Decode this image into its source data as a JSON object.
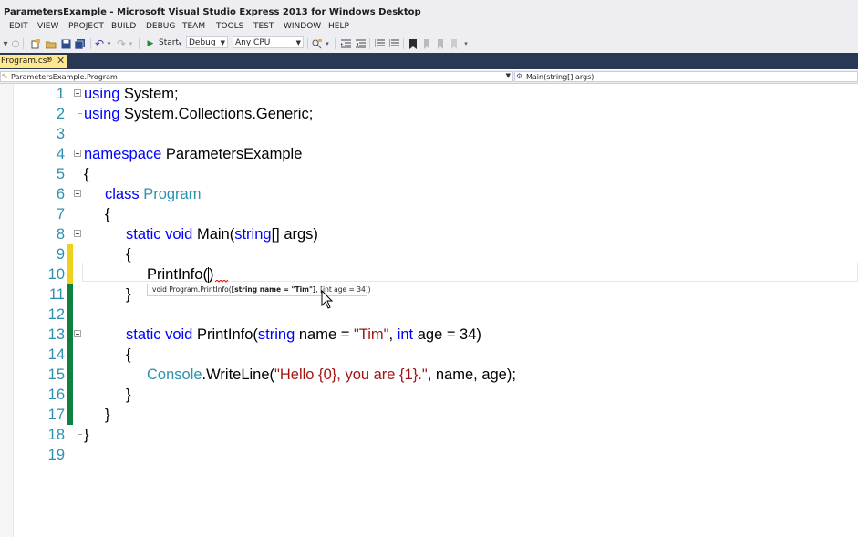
{
  "window": {
    "title": "ParametersExample - Microsoft Visual Studio Express 2013 for Windows Desktop"
  },
  "menu": [
    "EDIT",
    "VIEW",
    "PROJECT",
    "BUILD",
    "DEBUG",
    "TEAM",
    "TOOLS",
    "TEST",
    "WINDOW",
    "HELP"
  ],
  "toolbar": {
    "start_label": "Start",
    "configuration": "Debug",
    "platform": "Any CPU"
  },
  "tab": {
    "label": "Program.cs*",
    "pin": "⊕",
    "close": "✕"
  },
  "navbar": {
    "class_path": "ParametersExample.Program",
    "member": "Main(string[] args)"
  },
  "code": {
    "line_numbers": [
      "1",
      "2",
      "3",
      "4",
      "5",
      "6",
      "7",
      "8",
      "9",
      "10",
      "11",
      "12",
      "13",
      "14",
      "15",
      "16",
      "17",
      "18",
      "19"
    ],
    "l1_kw": "using",
    "l1_rest": " System;",
    "l2_kw": "using",
    "l2_rest": " System.Collections.Generic;",
    "l4_kw": "namespace",
    "l4_rest": " ParametersExample",
    "open_brace": "{",
    "close_brace": "}",
    "l6_kw": "class",
    "l6_type": "Program",
    "l8_kw": "static void",
    "l8_name": " Main(",
    "l8_type": "string",
    "l8_rest": "[] args)",
    "l10_text": "PrintInfo(",
    "l10_close": ")",
    "l13_kw": "static void",
    "l13_name": " PrintInfo(",
    "l13_type1": "string",
    "l13_mid1": " name = ",
    "l13_str": "\"Tim\"",
    "l13_mid2": ", ",
    "l13_type2": "int",
    "l13_rest": " age = 34)",
    "l15_type": "Console",
    "l15_mid": ".WriteLine(",
    "l15_str": "\"Hello {0}, you are {1}.\"",
    "l15_rest": ", name, age);"
  },
  "tooltip": {
    "prefix": "void Program.PrintInfo(",
    "param1": "[string name = \"Tim\"]",
    "separator": ", ",
    "param2": "[int age = 34]",
    "suffix": ")"
  },
  "colors": {
    "keyword": "#0000ff",
    "type": "#2b91af",
    "string": "#a31515",
    "saved_change": "#108040",
    "unsaved_change": "#efd01b",
    "tab_active": "#ffe88d"
  }
}
